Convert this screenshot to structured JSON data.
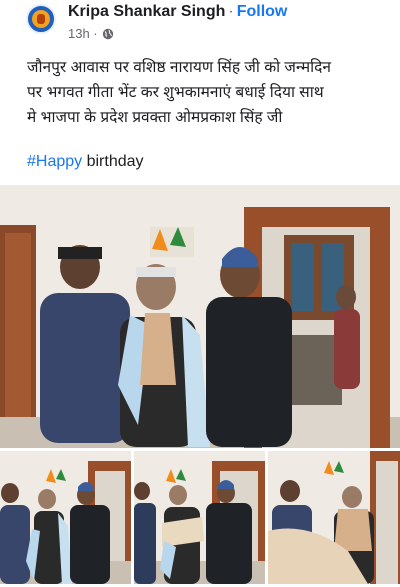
{
  "post": {
    "author": "Kripa Shankar Singh",
    "separator": "·",
    "follow_label": "Follow",
    "time": "13h ·",
    "privacy_icon": "globe-icon",
    "text_lines": [
      "जौनपुर आवास पर वशिष्ठ नारायण सिंह जी को जन्मदिन",
      "पर भगवत गीता भेंट कर शुभकामनाएं बधाई दिया साथ",
      "मे भाजपा के प्रदेश प्रवक्ता ओमप्रकाश सिंह जी"
    ],
    "hashtag": "#Happy",
    "hashtag_rest": " birthday"
  },
  "photos": {
    "count": 4,
    "main_alt": "photo-1",
    "thumb_alts": [
      "photo-2",
      "photo-3",
      "photo-4"
    ]
  },
  "colors": {
    "link": "#1877f2",
    "text": "#1c1e21",
    "muted": "#65676b"
  }
}
